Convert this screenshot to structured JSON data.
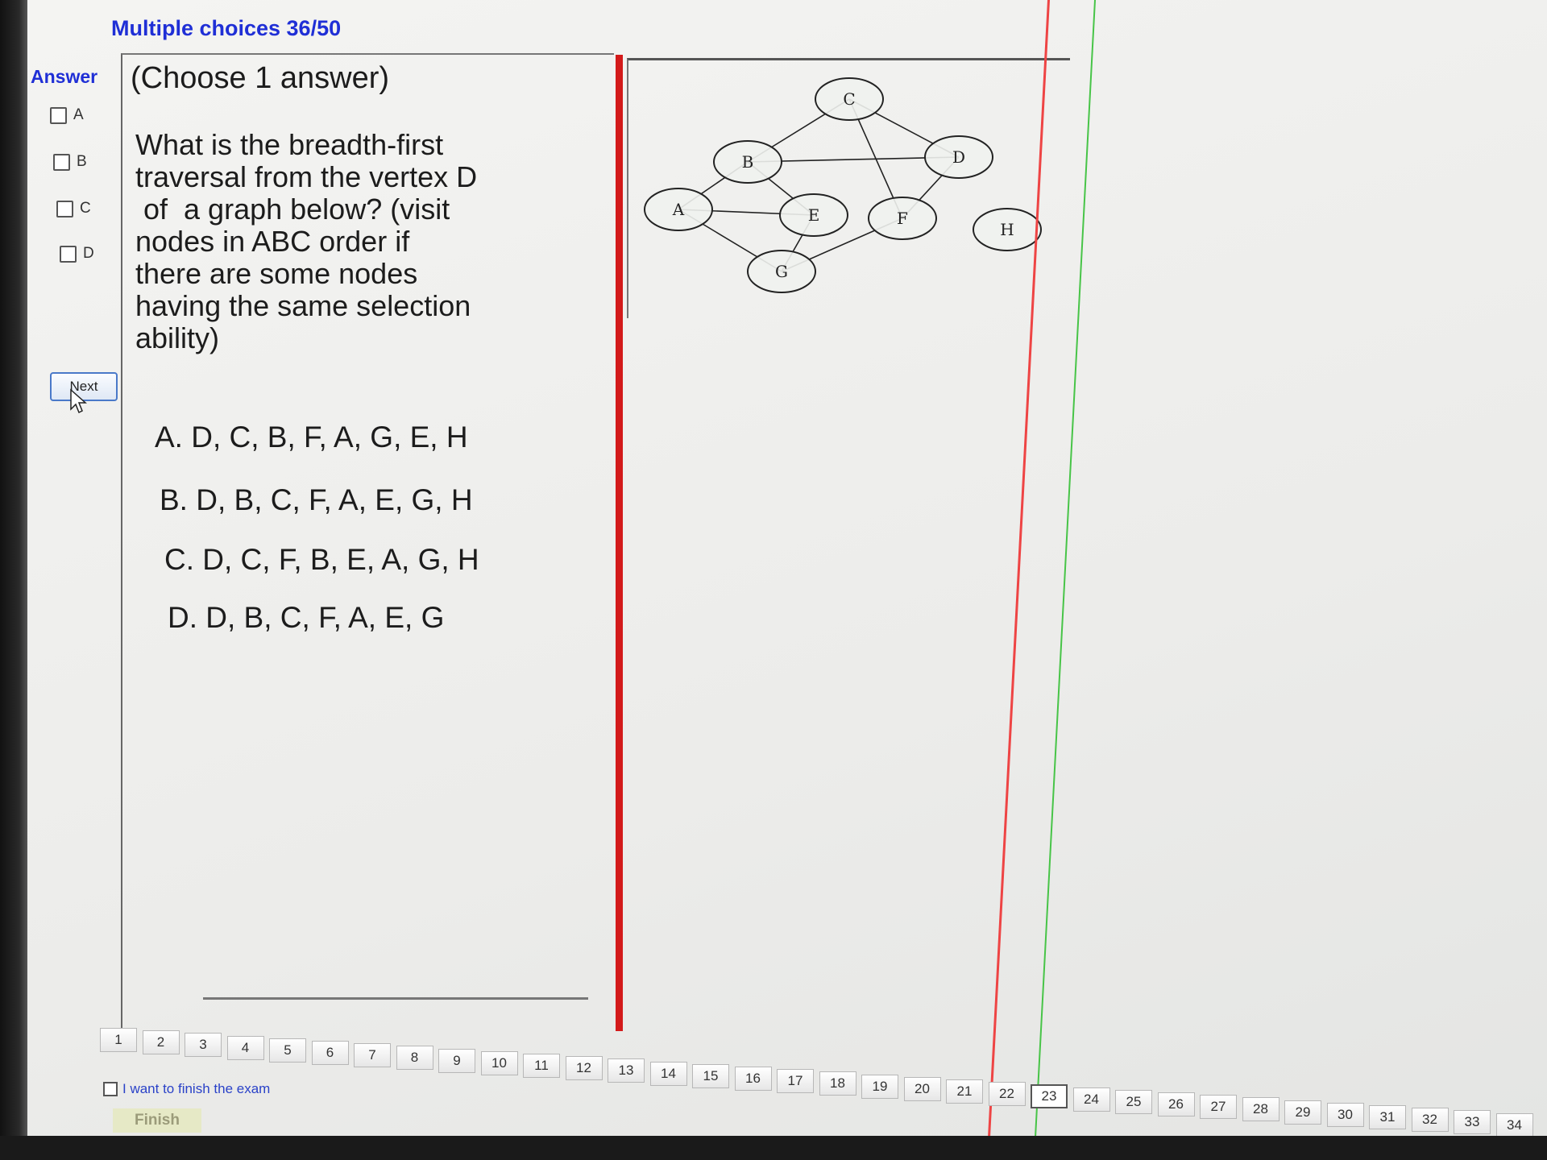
{
  "header": {
    "title": "Multiple choices 36/50"
  },
  "answer": {
    "label": "Answer",
    "options": [
      "A",
      "B",
      "C",
      "D"
    ]
  },
  "nav": {
    "next_label": "Next"
  },
  "question": {
    "instruction": "(Choose 1 answer)",
    "text_lines": [
      "What is the  breadth-first",
      "traversal from the vertex  D",
      " of  a graph below? (visit",
      "nodes in ABC order if",
      "there are some nodes",
      "having the same selection",
      "ability)"
    ],
    "options": [
      "A.  D, C, B, F, A, G, E, H",
      "B.  D, B, C, F, A, E, G, H",
      "C.  D, C, F, B, E, A, G, H",
      "D.  D, B, C, F, A, E, G"
    ]
  },
  "graph": {
    "nodes": [
      "A",
      "B",
      "C",
      "D",
      "E",
      "F",
      "G",
      "H"
    ],
    "edges": [
      [
        "A",
        "B"
      ],
      [
        "A",
        "E"
      ],
      [
        "A",
        "G"
      ],
      [
        "B",
        "C"
      ],
      [
        "B",
        "D"
      ],
      [
        "B",
        "E"
      ],
      [
        "C",
        "D"
      ],
      [
        "C",
        "F"
      ],
      [
        "D",
        "F"
      ],
      [
        "E",
        "G"
      ],
      [
        "F",
        "G"
      ]
    ]
  },
  "pager": {
    "pages": [
      "1",
      "2",
      "3",
      "4",
      "5",
      "6",
      "7",
      "8",
      "9",
      "10",
      "11",
      "12",
      "13",
      "14",
      "15",
      "16",
      "17",
      "18",
      "19",
      "20",
      "21",
      "22",
      "23",
      "24",
      "25",
      "26",
      "27",
      "28",
      "29",
      "30",
      "31",
      "32",
      "33",
      "34"
    ],
    "current": "23"
  },
  "finish": {
    "checkbox_label": "I want to finish the exam",
    "button_label": "Finish"
  }
}
